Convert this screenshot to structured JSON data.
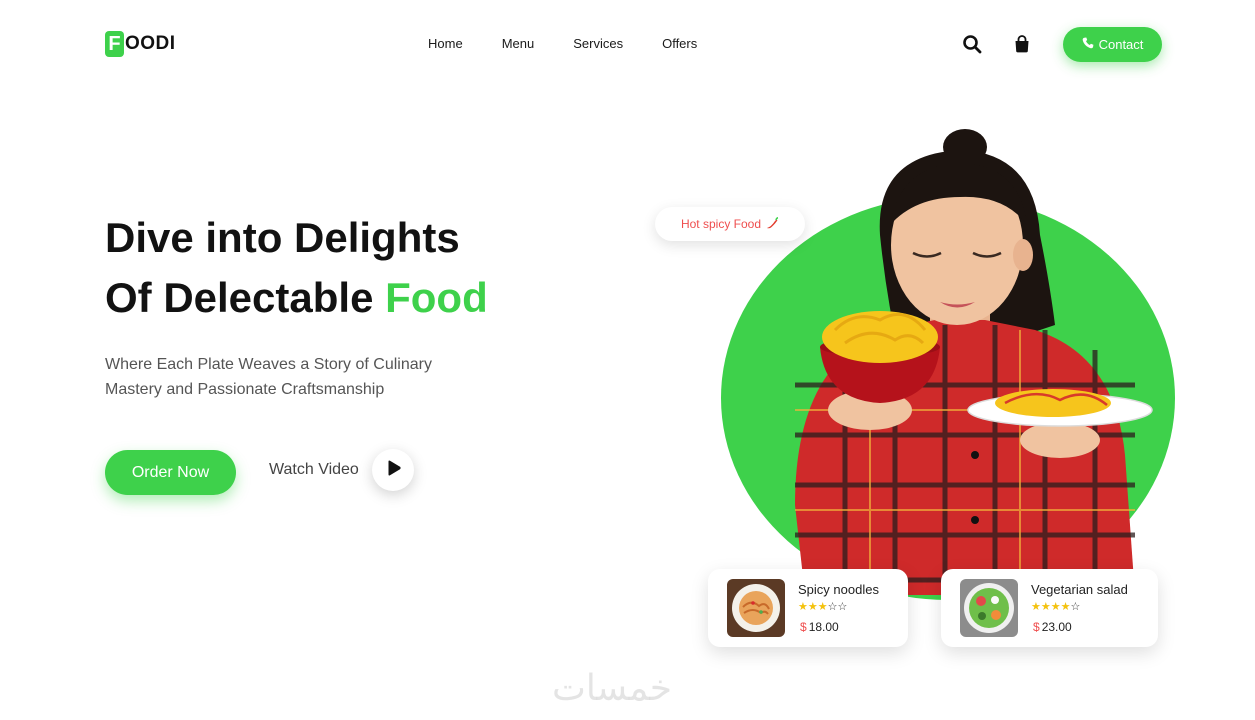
{
  "brand": {
    "logo_letter": "F",
    "logo_rest": "OODI"
  },
  "nav": {
    "items": [
      {
        "label": "Home"
      },
      {
        "label": "Menu"
      },
      {
        "label": "Services"
      },
      {
        "label": "Offers"
      }
    ]
  },
  "header": {
    "contact_label": "Contact",
    "icons": [
      "search-icon",
      "shopping-bag-icon",
      "phone-icon"
    ]
  },
  "hero": {
    "title_line1": "Dive into Delights",
    "title_line2_prefix": "Of Delectable ",
    "title_line2_accent": "Food",
    "subtitle": "Where Each Plate Weaves a Story of Culinary Mastery and Passionate Craftsmanship",
    "order_label": "Order Now",
    "watch_label": "Watch Video",
    "bubble_text": "Hot spicy Food"
  },
  "cards": [
    {
      "name": "Spicy noodles",
      "rating": 3,
      "max_rating": 5,
      "currency": "$",
      "price": "18.00"
    },
    {
      "name": "Vegetarian salad",
      "rating": 4,
      "max_rating": 5,
      "currency": "$",
      "price": "23.00"
    }
  ],
  "colors": {
    "accent": "#3ed14b",
    "price_currency": "#ef4e4e",
    "star": "#f4c20d"
  },
  "watermark": "خمسات"
}
